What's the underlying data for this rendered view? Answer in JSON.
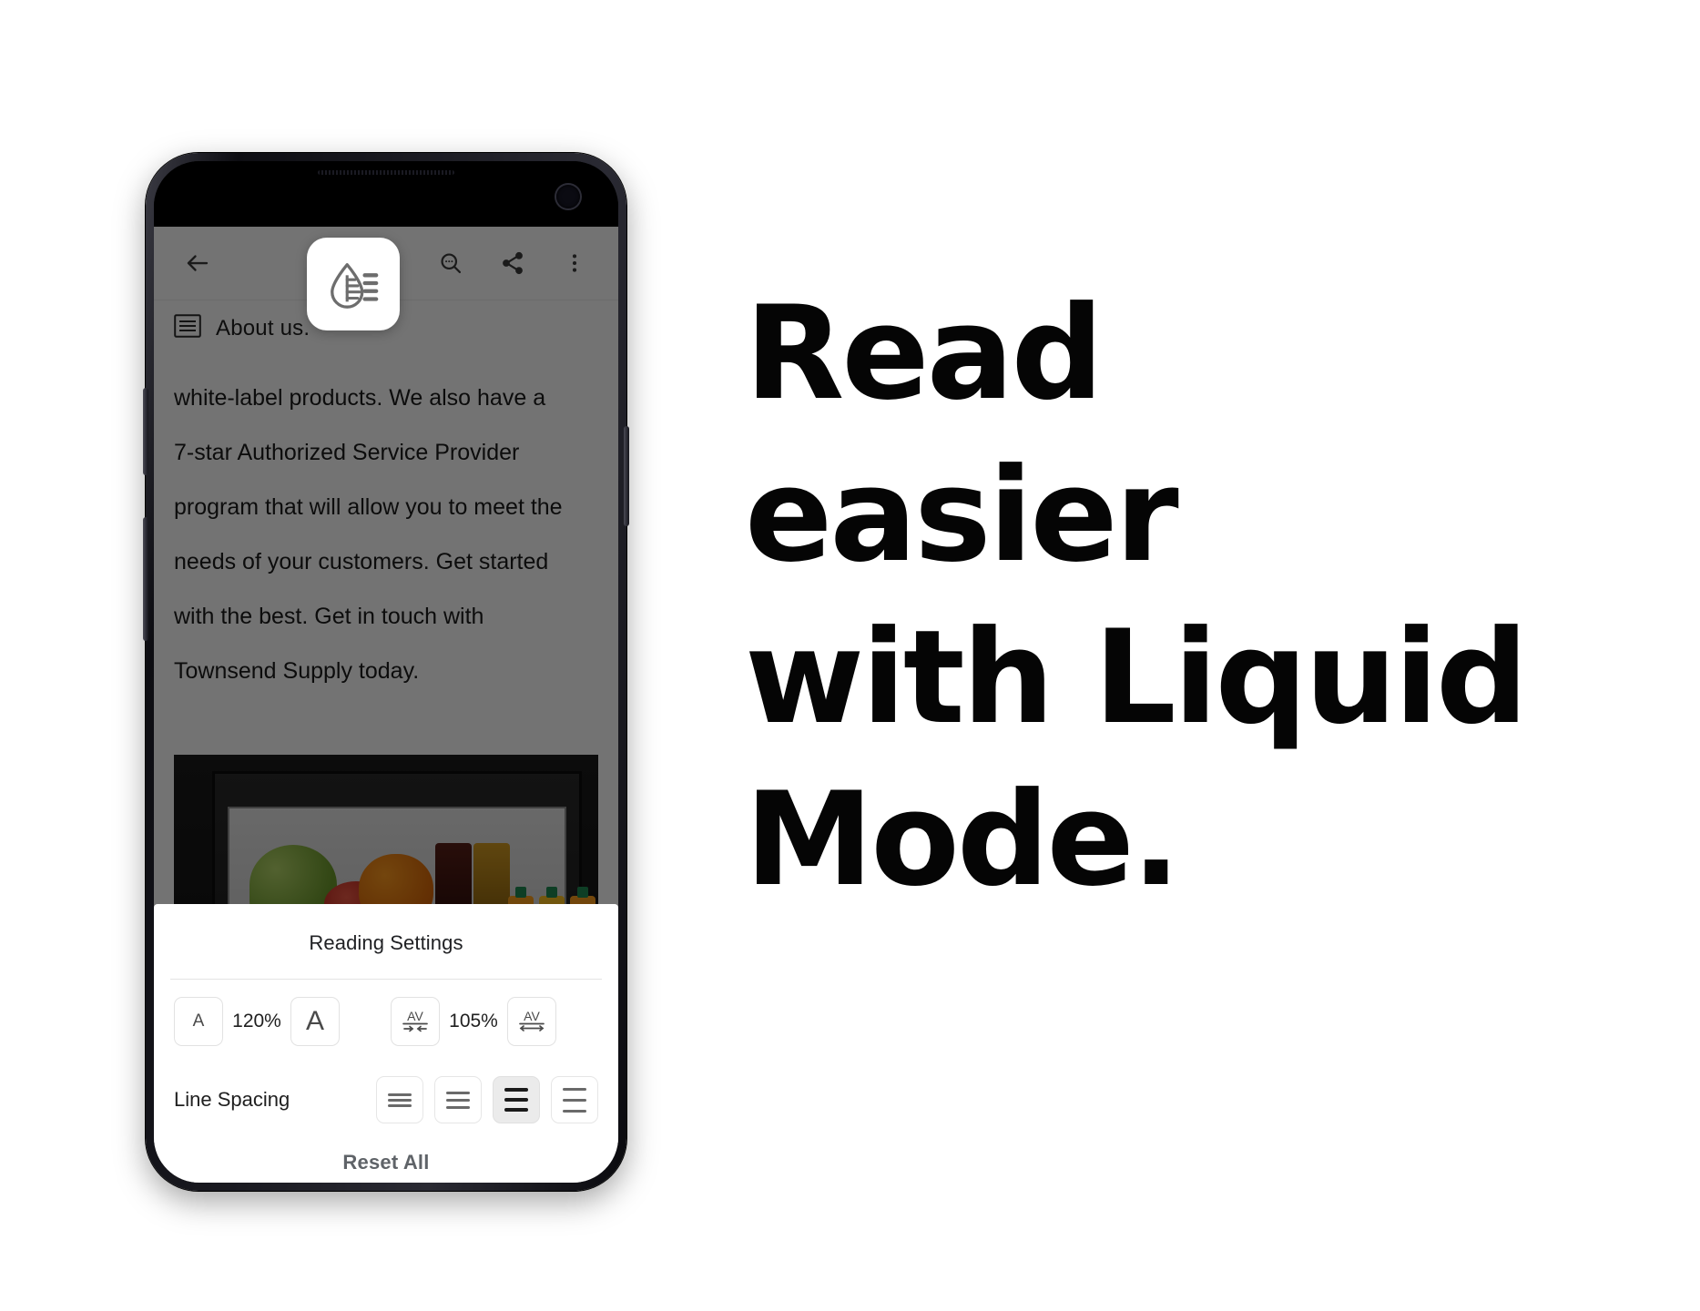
{
  "headline": "Read easier\nwith Liquid\nMode.",
  "phone": {
    "toolbar": {
      "back_icon": "back-arrow-icon",
      "search_icon": "find-in-page-icon",
      "share_icon": "share-icon",
      "overflow_icon": "more-vertical-icon"
    },
    "liquid_icon": "liquid-mode-droplet-icon",
    "document": {
      "outline_icon": "document-outline-icon",
      "title": "About us.",
      "body": "white-label products. We also have a\n7-star Authorized Service Provider\nprogram that will allow you to meet the\nneeds of your customers. Get started\nwith the best. Get in touch with\nTownsend Supply today."
    }
  },
  "sheet": {
    "title": "Reading Settings",
    "font_size": {
      "decrease_label": "A",
      "value": "120%",
      "increase_label": "A"
    },
    "letter_spacing": {
      "decrease_label": "AV",
      "value": "105%",
      "increase_label": "AV"
    },
    "line_spacing": {
      "label": "Line Spacing",
      "options": [
        "tight",
        "normal",
        "relaxed",
        "loose"
      ],
      "selected_index": 2
    },
    "reset_label": "Reset All"
  },
  "colors": {
    "page_background": "#ffffff",
    "headline": "#050505",
    "sheet_background": "#ffffff",
    "selected_control": "#ebebeb",
    "scrim": "rgba(0,0,0,0.55)",
    "icon_gray": "#6a6a6a"
  }
}
